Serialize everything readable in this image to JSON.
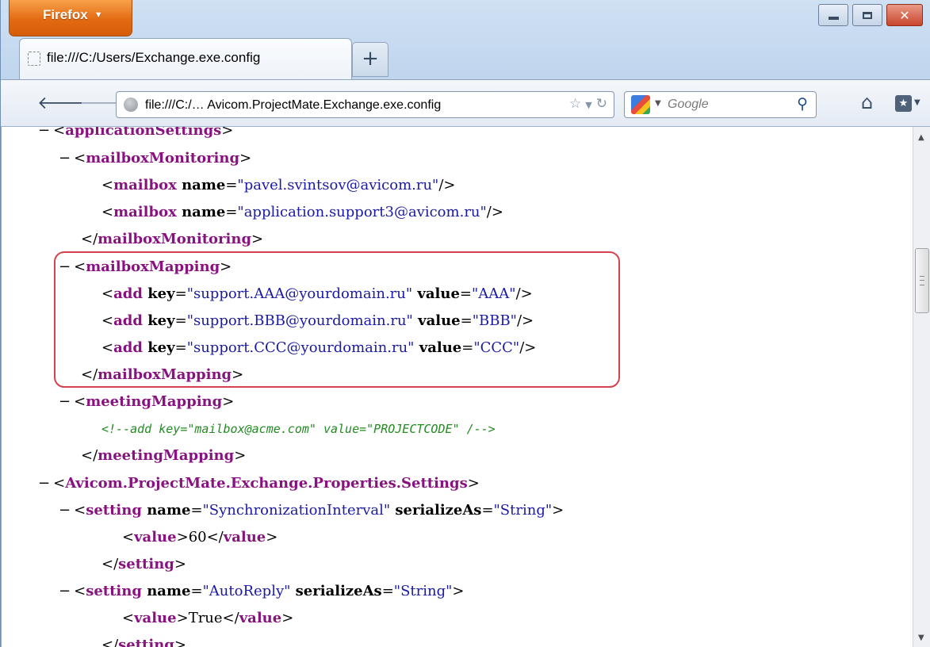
{
  "browser": {
    "menu_label": "Firefox",
    "tab_title": "file:///C:/Users/Exchange.exe.config",
    "new_tab_symbol": "+",
    "url": "file:///C:/… Avicom.ProjectMate.Exchange.exe.config",
    "search_placeholder": "Google"
  },
  "xml": {
    "lines": [
      {
        "minus": "−",
        "pre": "<",
        "tag": "applicationSettings",
        "post": ">"
      },
      {
        "minus": "−",
        "pre": "<",
        "tag": "mailboxMonitoring",
        "post": ">"
      },
      {
        "pre": "<",
        "tag": "mailbox",
        "a1": " name",
        "eq1": "=",
        "v1": "\"pavel.svintsov@avicom.ru\"",
        "post": "/>"
      },
      {
        "pre": "<",
        "tag": "mailbox",
        "a1": " name",
        "eq1": "=",
        "v1": "\"application.support3@avicom.ru\"",
        "post": "/>"
      },
      {
        "pre": "</",
        "tag": "mailboxMonitoring",
        "post": ">"
      },
      {
        "minus": "−",
        "pre": "<",
        "tag": "mailboxMapping",
        "post": ">"
      },
      {
        "pre": "<",
        "tag": "add",
        "a1": " key",
        "eq1": "=",
        "v1": "\"support.AAA@yourdomain.ru\"",
        "a2": " value",
        "eq2": "=",
        "v2": "\"AAA\"",
        "post": "/>"
      },
      {
        "pre": "<",
        "tag": "add",
        "a1": " key",
        "eq1": "=",
        "v1": "\"support.BBB@yourdomain.ru\"",
        "a2": " value",
        "eq2": "=",
        "v2": "\"BBB\"",
        "post": "/>"
      },
      {
        "pre": "<",
        "tag": "add",
        "a1": " key",
        "eq1": "=",
        "v1": "\"support.CCC@yourdomain.ru\"",
        "a2": " value",
        "eq2": "=",
        "v2": "\"CCC\"",
        "post": "/>"
      },
      {
        "pre": "</",
        "tag": "mailboxMapping",
        "post": ">"
      },
      {
        "minus": "−",
        "pre": "<",
        "tag": "meetingMapping",
        "post": ">"
      },
      {
        "comment": "<!--add key=\"mailbox@acme.com\" value=\"PROJECTCODE\" /-->"
      },
      {
        "pre": "</",
        "tag": "meetingMapping",
        "post": ">"
      },
      {
        "minus": "−",
        "pre": "<",
        "tag": "Avicom.ProjectMate.Exchange.Properties.Settings",
        "post": ">"
      },
      {
        "minus": "−",
        "pre": "<",
        "tag": "setting",
        "a1": " name",
        "eq1": "=",
        "v1": "\"SynchronizationInterval\"",
        "a2": " serializeAs",
        "eq2": "=",
        "v2": "\"String\"",
        "post": ">"
      },
      {
        "pre": "<",
        "tag": "value",
        "post": ">",
        "text": "60",
        "pre2": "</",
        "tag2": "value",
        "post2": ">"
      },
      {
        "pre": "</",
        "tag": "setting",
        "post": ">"
      },
      {
        "minus": "−",
        "pre": "<",
        "tag": "setting",
        "a1": " name",
        "eq1": "=",
        "v1": "\"AutoReply\"",
        "a2": " serializeAs",
        "eq2": "=",
        "v2": "\"String\"",
        "post": ">"
      },
      {
        "pre": "<",
        "tag": "value",
        "post": ">",
        "text": "True",
        "pre2": "</",
        "tag2": "value",
        "post2": ">"
      },
      {
        "pre": "</",
        "tag": "setting",
        "post": ">"
      }
    ]
  }
}
